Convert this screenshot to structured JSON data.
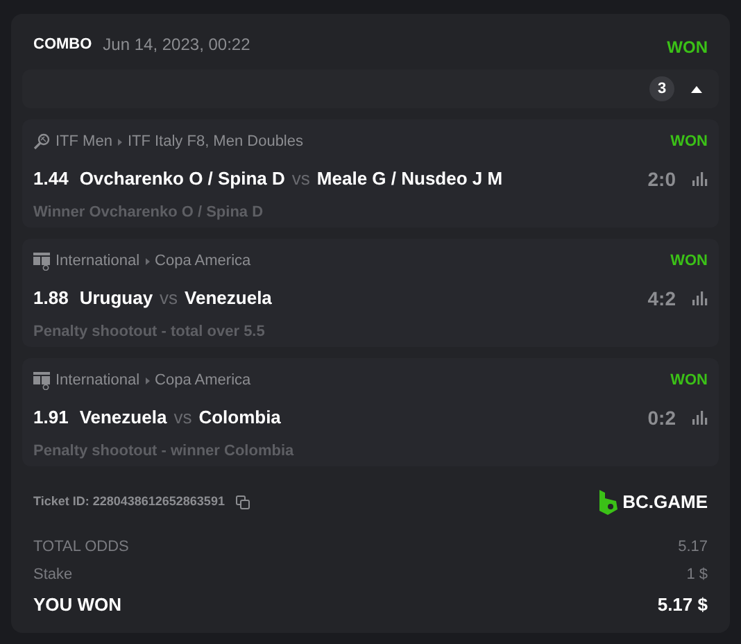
{
  "bet": {
    "type": "COMBO",
    "date": "Jun 14, 2023, 00:22",
    "status": "WON"
  },
  "legs_bar": {
    "count": "3",
    "expanded": true
  },
  "legs": [
    {
      "kind": "tennis",
      "category": "ITF Men",
      "tournament": "ITF Italy F8, Men Doubles",
      "status": "WON",
      "odds": "1.44",
      "home": "Ovcharenko O / Spina D",
      "vs": "vs",
      "away": "Meale G / Nusdeo J M",
      "score": "2:0",
      "market": "Winner Ovcharenko O / Spina D"
    },
    {
      "kind": "fifa",
      "category": "International",
      "tournament": "Copa America",
      "status": "WON",
      "odds": "1.88",
      "home": "Uruguay",
      "vs": "vs",
      "away": "Venezuela",
      "score": "4:2",
      "market": "Penalty shootout - total over 5.5"
    },
    {
      "kind": "fifa",
      "category": "International",
      "tournament": "Copa America",
      "status": "WON",
      "odds": "1.91",
      "home": "Venezuela",
      "vs": "vs",
      "away": "Colombia",
      "score": "0:2",
      "market": "Penalty shootout - winner Colombia"
    }
  ],
  "ticket": {
    "label": "Ticket ID: 2280438612652863591",
    "brand": "BC.GAME"
  },
  "summary": [
    {
      "kind": "normal",
      "label": "TOTAL ODDS",
      "value": "5.17"
    },
    {
      "kind": "normal",
      "label": "Stake",
      "value": "1 $"
    },
    {
      "kind": "total",
      "label": "YOU WON",
      "value": "5.17 $"
    }
  ]
}
